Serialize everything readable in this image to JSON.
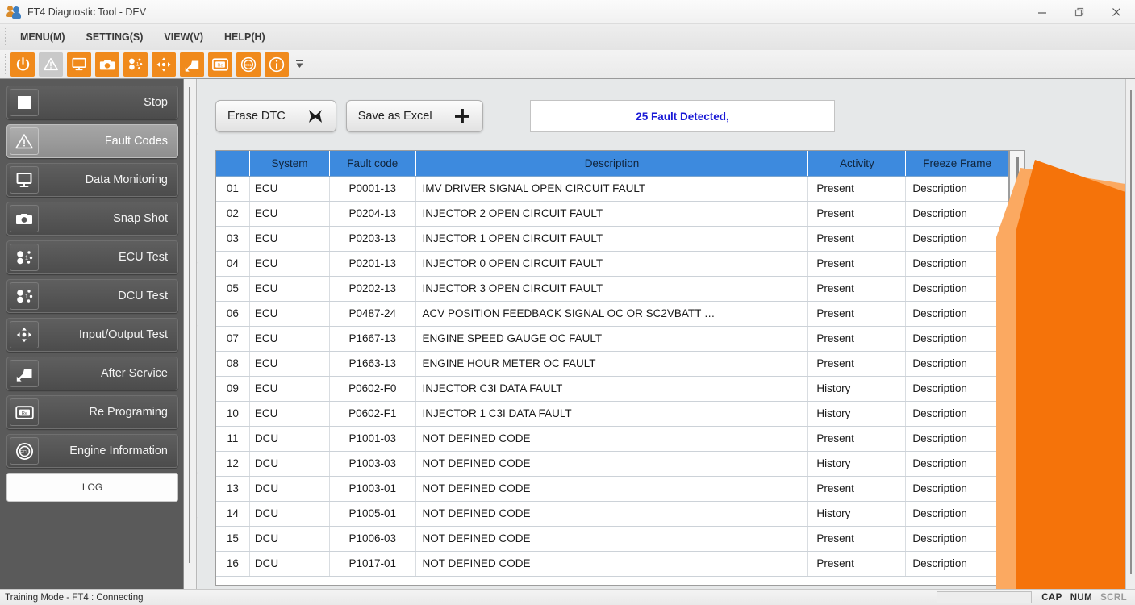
{
  "window": {
    "title": "FT4 Diagnostic Tool - DEV",
    "app_icon": "people-icon",
    "controls": {
      "minimize": "minimize-icon",
      "maximize": "restore-icon",
      "close": "close-icon"
    }
  },
  "menubar": {
    "items": [
      {
        "label": "MENU(M)",
        "name": "menu-menu"
      },
      {
        "label": "SETTING(S)",
        "name": "menu-setting"
      },
      {
        "label": "VIEW(V)",
        "name": "menu-view"
      },
      {
        "label": "HELP(H)",
        "name": "menu-help"
      }
    ]
  },
  "toolbar": {
    "buttons": [
      {
        "icon": "power-icon",
        "style": "orange"
      },
      {
        "icon": "warning-icon",
        "style": "grey"
      },
      {
        "icon": "monitor-icon",
        "style": "orange"
      },
      {
        "icon": "camera-icon",
        "style": "orange"
      },
      {
        "icon": "ecu-test-icon",
        "style": "orange"
      },
      {
        "icon": "input-output-icon",
        "style": "orange"
      },
      {
        "icon": "after-service-icon",
        "style": "orange"
      },
      {
        "icon": "reprogram-icon",
        "style": "orange"
      },
      {
        "icon": "engine-info-icon",
        "style": "orange"
      },
      {
        "icon": "information-icon",
        "style": "orange"
      }
    ],
    "overflow": "toolbar-overflow-icon"
  },
  "sidebar": {
    "items": [
      {
        "label": "Stop",
        "icon": "stop-square-icon",
        "active": false
      },
      {
        "label": "Fault Codes",
        "icon": "warning-icon",
        "active": true
      },
      {
        "label": "Data Monitoring",
        "icon": "monitor-icon",
        "active": false
      },
      {
        "label": "Snap Shot",
        "icon": "camera-icon",
        "active": false
      },
      {
        "label": "ECU Test",
        "icon": "ecu-test-icon",
        "active": false
      },
      {
        "label": "DCU Test",
        "icon": "ecu-test-icon",
        "active": false
      },
      {
        "label": "Input/Output Test",
        "icon": "input-output-icon",
        "active": false
      },
      {
        "label": "After Service",
        "icon": "after-service-icon",
        "active": false
      },
      {
        "label": "Re Programing",
        "icon": "reprogram-icon",
        "active": false
      },
      {
        "label": "Engine Information",
        "icon": "engine-info-icon",
        "active": false
      }
    ],
    "log_button": "LOG"
  },
  "actions": {
    "erase_dtc": {
      "label": "Erase DTC",
      "icon": "x-mark-icon"
    },
    "save_as_excel": {
      "label": "Save as Excel",
      "icon": "plus-icon"
    }
  },
  "banner": {
    "text": "25 Fault Detected,",
    "color": "#1a1ad6"
  },
  "table": {
    "header_color": "#3d8ade",
    "columns": [
      "",
      "System",
      "Fault code",
      "Description",
      "Activity",
      "Freeze Frame"
    ],
    "rows": [
      {
        "no": "01",
        "system": "ECU",
        "code": "P0001-13",
        "description": "IMV DRIVER SIGNAL OPEN CIRCUIT FAULT",
        "activity": "Present",
        "freeze": "Description"
      },
      {
        "no": "02",
        "system": "ECU",
        "code": "P0204-13",
        "description": "INJECTOR 2 OPEN CIRCUIT FAULT",
        "activity": "Present",
        "freeze": "Description"
      },
      {
        "no": "03",
        "system": "ECU",
        "code": "P0203-13",
        "description": "INJECTOR 1 OPEN CIRCUIT FAULT",
        "activity": "Present",
        "freeze": "Description"
      },
      {
        "no": "04",
        "system": "ECU",
        "code": "P0201-13",
        "description": "INJECTOR 0 OPEN CIRCUIT FAULT",
        "activity": "Present",
        "freeze": "Description"
      },
      {
        "no": "05",
        "system": "ECU",
        "code": "P0202-13",
        "description": "INJECTOR 3 OPEN CIRCUIT FAULT",
        "activity": "Present",
        "freeze": "Description"
      },
      {
        "no": "06",
        "system": "ECU",
        "code": "P0487-24",
        "description": "ACV POSITION FEEDBACK SIGNAL OC OR SC2VBATT …",
        "activity": "Present",
        "freeze": "Description"
      },
      {
        "no": "07",
        "system": "ECU",
        "code": "P1667-13",
        "description": "ENGINE SPEED GAUGE OC FAULT",
        "activity": "Present",
        "freeze": "Description"
      },
      {
        "no": "08",
        "system": "ECU",
        "code": "P1663-13",
        "description": "ENGINE HOUR METER OC FAULT",
        "activity": "Present",
        "freeze": "Description"
      },
      {
        "no": "09",
        "system": "ECU",
        "code": "P0602-F0",
        "description": "INJECTOR C3I DATA FAULT",
        "activity": "History",
        "freeze": "Description"
      },
      {
        "no": "10",
        "system": "ECU",
        "code": "P0602-F1",
        "description": "INJECTOR 1 C3I DATA FAULT",
        "activity": "History",
        "freeze": "Description"
      },
      {
        "no": "11",
        "system": "DCU",
        "code": "P1001-03",
        "description": "NOT DEFINED CODE",
        "activity": "Present",
        "freeze": "Description"
      },
      {
        "no": "12",
        "system": "DCU",
        "code": "P1003-03",
        "description": "NOT DEFINED CODE",
        "activity": "History",
        "freeze": "Description"
      },
      {
        "no": "13",
        "system": "DCU",
        "code": "P1003-01",
        "description": "NOT DEFINED CODE",
        "activity": "Present",
        "freeze": "Description"
      },
      {
        "no": "14",
        "system": "DCU",
        "code": "P1005-01",
        "description": "NOT DEFINED CODE",
        "activity": "History",
        "freeze": "Description"
      },
      {
        "no": "15",
        "system": "DCU",
        "code": "P1006-03",
        "description": "NOT DEFINED CODE",
        "activity": "Present",
        "freeze": "Description"
      },
      {
        "no": "16",
        "system": "DCU",
        "code": "P1017-01",
        "description": "NOT DEFINED CODE",
        "activity": "Present",
        "freeze": "Description"
      }
    ]
  },
  "statusbar": {
    "message": "Training Mode - FT4 : Connecting",
    "indicators": [
      {
        "label": "CAP",
        "dim": false
      },
      {
        "label": "NUM",
        "dim": false
      },
      {
        "label": "SCRL",
        "dim": true
      }
    ]
  },
  "theme": {
    "accent_orange": "#f5730a",
    "accent_orange_light": "#fba961",
    "toolbar_orange": "#f08a1c",
    "sidebar_bg": "#5a5a5a",
    "header_blue": "#3d8ade"
  }
}
